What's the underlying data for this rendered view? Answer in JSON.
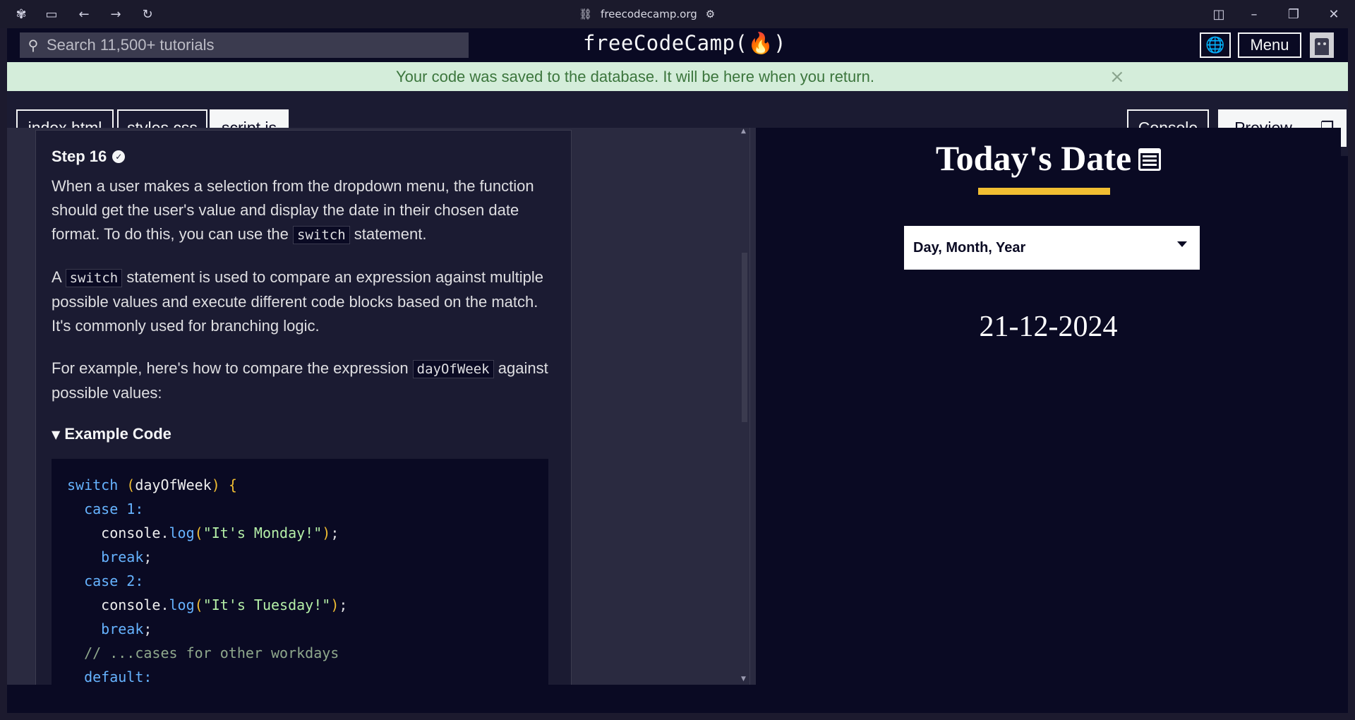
{
  "browser": {
    "url": "freecodecamp.org"
  },
  "navbar": {
    "search_placeholder": "Search 11,500+ tutorials",
    "logo": "freeCodeCamp(🔥)",
    "menu_label": "Menu"
  },
  "flash": {
    "message": "Your code was saved to the database. It will be here when you return.",
    "close": "×"
  },
  "editor_tabs": [
    {
      "label": "index.html",
      "active": false
    },
    {
      "label": "styles.css",
      "active": false
    },
    {
      "label": "script.js",
      "active": true
    }
  ],
  "panel_buttons": {
    "console": "Console",
    "preview": "Preview"
  },
  "lesson": {
    "step": "Step 16",
    "para1_a": "When a user makes a selection from the dropdown menu, the function should get the user's value and display the date in their chosen date format. To do this, you can use the ",
    "para1_code": "switch",
    "para1_b": " statement.",
    "para2_a": "A ",
    "para2_code": "switch",
    "para2_b": " statement is used to compare an expression against multiple possible values and execute different code blocks based on the match. It's commonly used for branching logic.",
    "para3_a": "For example, here's how to compare the expression ",
    "para3_code": "dayOfWeek",
    "para3_b": " against possible values:",
    "example_summary": "Example Code",
    "code": {
      "l1_kw": "switch",
      "l1_var": "dayOfWeek",
      "case1": "case 1:",
      "log_obj": "console",
      "log_fn": "log",
      "str1": "\"It's Monday!\"",
      "break": "break",
      "case2": "case 2:",
      "str2": "\"It's Tuesday!\"",
      "comment": "// ...cases for other workdays",
      "default": "default:"
    }
  },
  "preview": {
    "title": "Today's Date",
    "select_value": "Day, Month, Year",
    "date": "21-12-2024",
    "accent": "#f1be32"
  },
  "colors": {
    "bg_dark": "#0a0a23",
    "panel": "#1b1b32",
    "flash_bg": "#d4edda",
    "flash_text": "#3c763d"
  }
}
